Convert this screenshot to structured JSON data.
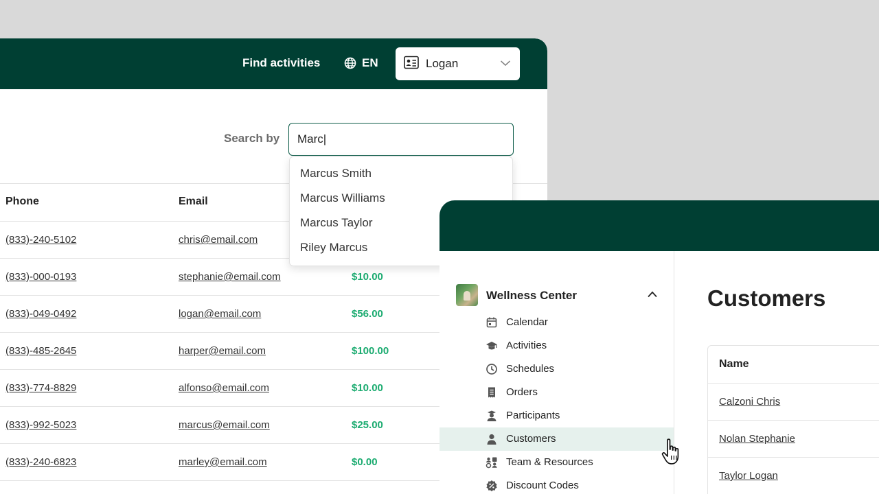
{
  "header": {
    "find_activities": "Find activities",
    "language": "EN",
    "user_name": "Logan"
  },
  "search": {
    "label": "Search by",
    "value": "Marc|",
    "suggestions": [
      "Marcus Smith",
      "Marcus Williams",
      "Marcus Taylor",
      "Riley Marcus"
    ]
  },
  "table": {
    "headers": {
      "phone": "Phone",
      "email": "Email"
    },
    "rows": [
      {
        "phone": "(833)-240-5102",
        "email": "chris@email.com",
        "amount": ""
      },
      {
        "phone": "(833)-000-0193",
        "email": "stephanie@email.com",
        "amount": "$10.00"
      },
      {
        "phone": "(833)-049-0492",
        "email": "logan@email.com",
        "amount": "$56.00"
      },
      {
        "phone": "(833)-485-2645",
        "email": "harper@email.com",
        "amount": "$100.00"
      },
      {
        "phone": "(833)-774-8829",
        "email": "alfonso@email.com",
        "amount": "$10.00"
      },
      {
        "phone": "(833)-992-5023",
        "email": "marcus@email.com",
        "amount": "$25.00"
      },
      {
        "phone": "(833)-240-6823",
        "email": "marley@email.com",
        "amount": "$0.00"
      }
    ]
  },
  "sidebar": {
    "org_name": "Wellness Center",
    "items": [
      {
        "label": "Calendar",
        "icon": "calendar-icon"
      },
      {
        "label": "Activities",
        "icon": "graduation-cap-icon"
      },
      {
        "label": "Schedules",
        "icon": "clock-icon"
      },
      {
        "label": "Orders",
        "icon": "receipt-icon"
      },
      {
        "label": "Participants",
        "icon": "participants-icon"
      },
      {
        "label": "Customers",
        "icon": "user-icon",
        "active": true
      },
      {
        "label": "Team & Resources",
        "icon": "team-icon"
      },
      {
        "label": "Discount Codes",
        "icon": "discount-icon"
      }
    ]
  },
  "customers": {
    "title": "Customers",
    "name_header": "Name",
    "names": [
      "Calzoni Chris",
      "Nolan Stephanie",
      "Taylor Logan"
    ]
  },
  "colors": {
    "header_bg": "#003f33",
    "accent_green": "#1bab70",
    "active_nav_bg": "#e6f1ed"
  }
}
